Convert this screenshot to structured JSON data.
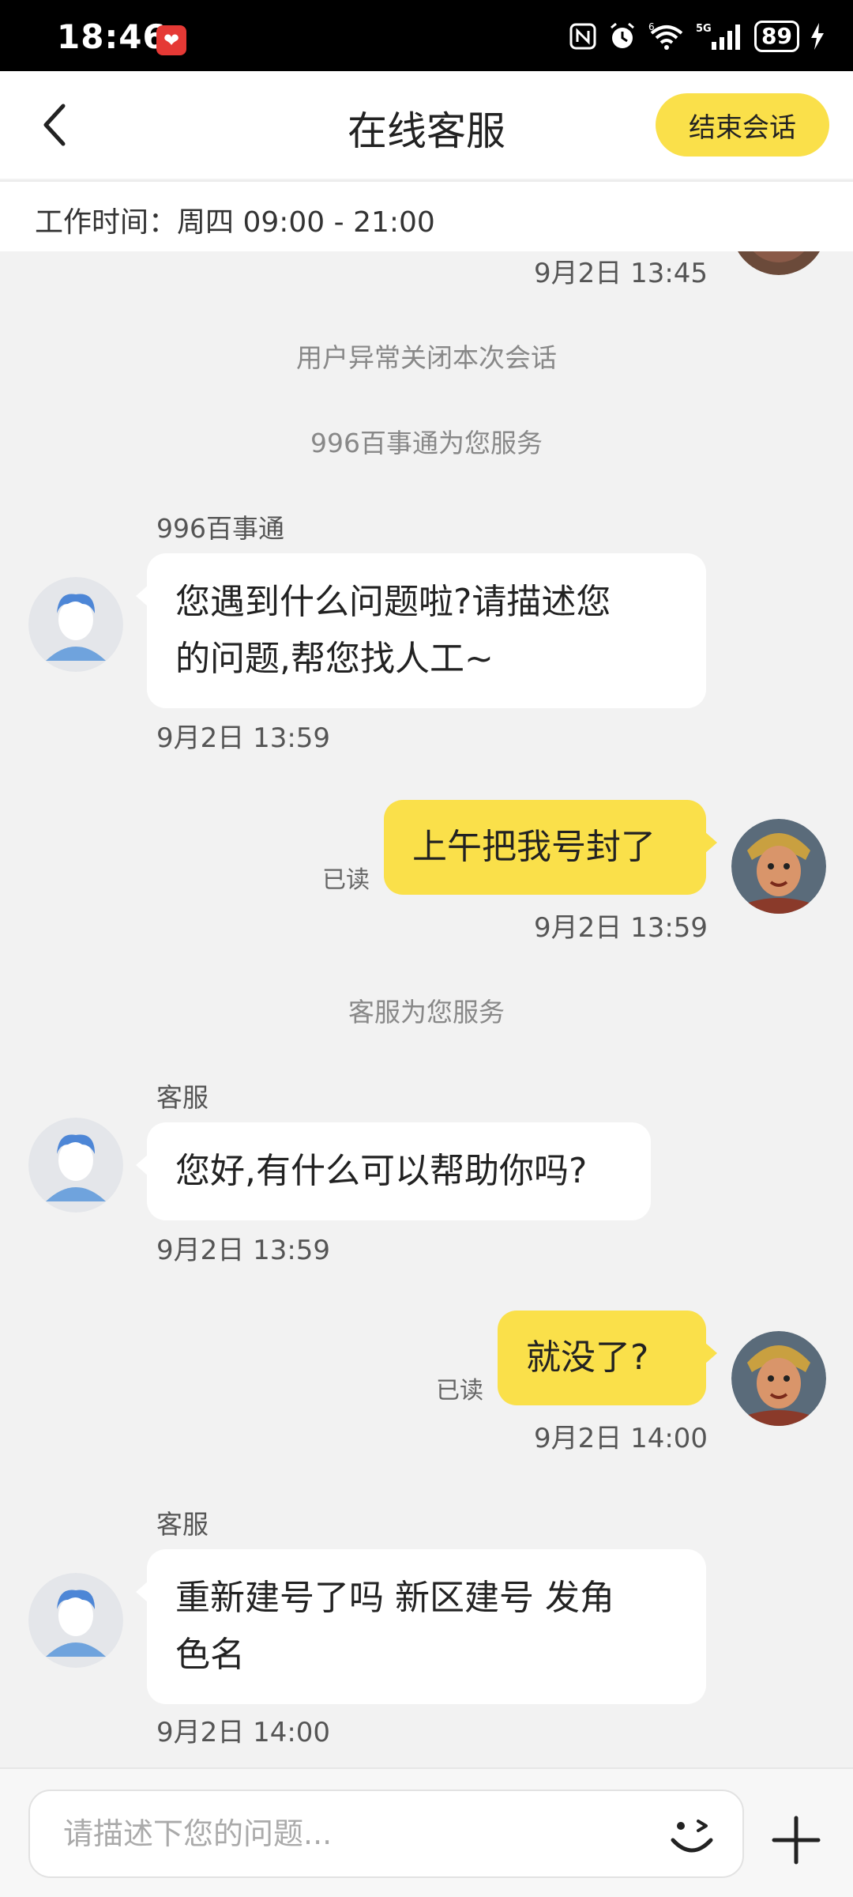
{
  "status_bar": {
    "time": "18:46",
    "app_badge": "❤",
    "icons": [
      "nfc-icon",
      "alarm-icon",
      "wifi-6-icon",
      "5g-signal-icon"
    ],
    "network": "5G",
    "wifi_label": "6",
    "battery": "89"
  },
  "header": {
    "title": "在线客服",
    "end_button": "结束会话",
    "work_hours": "工作时间：周四 09:00 - 21:00"
  },
  "chat": {
    "top_timestamp": "9月2日 13:45",
    "system_closed": "用户异常关闭本次会话",
    "system_bot": "996百事通为您服务",
    "msg1": {
      "sender": "996百事通",
      "line1": "您遇到什么问题啦?请描述您",
      "line2": "的问题,帮您找人工~",
      "time": "9月2日 13:59"
    },
    "msg2": {
      "text": "上午把我号封了",
      "status": "已读",
      "time": "9月2日 13:59"
    },
    "system_agent": "客服为您服务",
    "msg3": {
      "sender": "客服",
      "text": "您好,有什么可以帮助你吗?",
      "time": "9月2日 13:59"
    },
    "msg4": {
      "text": "就没了?",
      "status": "已读",
      "time": "9月2日 14:00"
    },
    "msg5": {
      "sender": "客服",
      "line1": "重新建号了吗 新区建号 发角",
      "line2": "色名",
      "time": "9月2日 14:00"
    }
  },
  "input": {
    "placeholder": "请描述下您的问题..."
  },
  "colors": {
    "accent": "#fae04a",
    "background": "#f2f2f2"
  }
}
